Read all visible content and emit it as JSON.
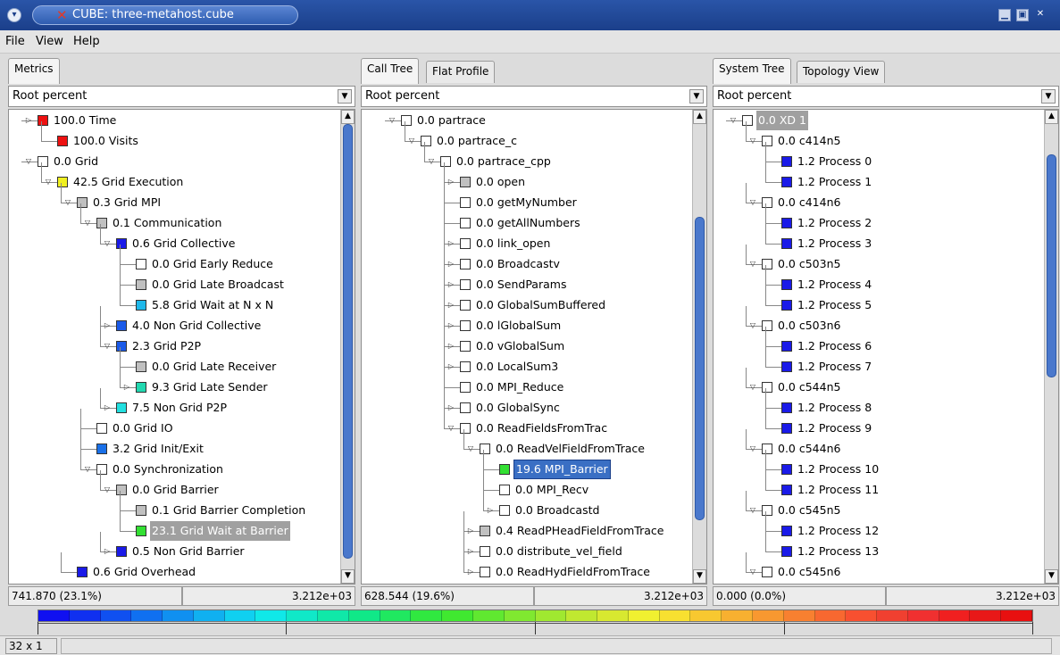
{
  "window": {
    "title": "CUBE: three-metahost.cube",
    "icon": "x-app-icon"
  },
  "menu": {
    "file": "File",
    "view": "View",
    "help": "Help"
  },
  "metrics": {
    "tab": "Metrics",
    "combo": "Root percent",
    "status_left": "741.870  (23.1%)",
    "status_right": "3.212e+03",
    "rows": [
      {
        "depth": 0,
        "exp": "right",
        "color": "#ee1111",
        "label": "100.0 Time"
      },
      {
        "depth": 1,
        "exp": "none",
        "color": "#ee1111",
        "label": "100.0 Visits"
      },
      {
        "depth": 0,
        "exp": "down",
        "color": "#ffffff",
        "label": "0.0 Grid"
      },
      {
        "depth": 1,
        "exp": "down",
        "color": "#f0f020",
        "label": "42.5 Grid Execution"
      },
      {
        "depth": 2,
        "exp": "down",
        "color": "#c0c0c0",
        "label": "0.3 Grid MPI"
      },
      {
        "depth": 3,
        "exp": "down",
        "color": "#c0c0c0",
        "label": "0.1 Communication"
      },
      {
        "depth": 4,
        "exp": "down",
        "color": "#1a1ae8",
        "label": "0.6 Grid Collective"
      },
      {
        "depth": 5,
        "exp": "none",
        "color": "#ffffff",
        "label": "0.0 Grid Early Reduce"
      },
      {
        "depth": 5,
        "exp": "none",
        "color": "#c0c0c0",
        "label": "0.0 Grid Late Broadcast"
      },
      {
        "depth": 5,
        "exp": "none",
        "color": "#1fb8ea",
        "label": "5.8 Grid Wait at N x N"
      },
      {
        "depth": 4,
        "exp": "right",
        "color": "#1a5ae8",
        "label": "4.0 Non Grid Collective"
      },
      {
        "depth": 4,
        "exp": "down",
        "color": "#1a5ae8",
        "label": "2.3 Grid P2P"
      },
      {
        "depth": 5,
        "exp": "none",
        "color": "#c0c0c0",
        "label": "0.0 Grid Late Receiver"
      },
      {
        "depth": 5,
        "exp": "right",
        "color": "#22d8b0",
        "label": "9.3 Grid Late Sender"
      },
      {
        "depth": 4,
        "exp": "right",
        "color": "#22e0e0",
        "label": "7.5 Non Grid P2P"
      },
      {
        "depth": 3,
        "exp": "none",
        "color": "#ffffff",
        "label": "0.0 Grid IO"
      },
      {
        "depth": 3,
        "exp": "none",
        "color": "#1a70e8",
        "label": "3.2 Grid Init/Exit"
      },
      {
        "depth": 3,
        "exp": "down",
        "color": "#ffffff",
        "label": "0.0 Synchronization"
      },
      {
        "depth": 4,
        "exp": "down",
        "color": "#c0c0c0",
        "label": "0.0 Grid Barrier"
      },
      {
        "depth": 5,
        "exp": "none",
        "color": "#c0c0c0",
        "label": "0.1 Grid Barrier Completion"
      },
      {
        "depth": 5,
        "exp": "none",
        "color": "#33e033",
        "label": "23.1 Grid Wait at Barrier",
        "state": "hl"
      },
      {
        "depth": 4,
        "exp": "right",
        "color": "#1a1ae8",
        "label": "0.5 Non Grid Barrier"
      },
      {
        "depth": 2,
        "exp": "none",
        "color": "#1a1ae8",
        "label": "0.6 Grid Overhead"
      }
    ]
  },
  "calltree": {
    "tab_active": "Call Tree",
    "tab_other": "Flat Profile",
    "combo": "Root percent",
    "status_left": "628.544  (19.6%)",
    "status_right": "3.212e+03",
    "rows": [
      {
        "depth": 0,
        "exp": "down",
        "color": "#ffffff",
        "label": "0.0 partrace"
      },
      {
        "depth": 1,
        "exp": "down",
        "color": "#ffffff",
        "label": "0.0 partrace_c"
      },
      {
        "depth": 2,
        "exp": "down",
        "color": "#ffffff",
        "label": "0.0 partrace_cpp"
      },
      {
        "depth": 3,
        "exp": "right",
        "color": "#c0c0c0",
        "label": "0.0 open"
      },
      {
        "depth": 3,
        "exp": "none",
        "color": "#ffffff",
        "label": "0.0 getMyNumber"
      },
      {
        "depth": 3,
        "exp": "none",
        "color": "#ffffff",
        "label": "0.0 getAllNumbers"
      },
      {
        "depth": 3,
        "exp": "right",
        "color": "#ffffff",
        "label": "0.0 link_open"
      },
      {
        "depth": 3,
        "exp": "right",
        "color": "#ffffff",
        "label": "0.0 Broadcastv"
      },
      {
        "depth": 3,
        "exp": "right",
        "color": "#ffffff",
        "label": "0.0 SendParams"
      },
      {
        "depth": 3,
        "exp": "right",
        "color": "#ffffff",
        "label": "0.0 GlobalSumBuffered"
      },
      {
        "depth": 3,
        "exp": "right",
        "color": "#ffffff",
        "label": "0.0 lGlobalSum"
      },
      {
        "depth": 3,
        "exp": "right",
        "color": "#ffffff",
        "label": "0.0 vGlobalSum"
      },
      {
        "depth": 3,
        "exp": "right",
        "color": "#ffffff",
        "label": "0.0 LocalSum3"
      },
      {
        "depth": 3,
        "exp": "none",
        "color": "#ffffff",
        "label": "0.0 MPI_Reduce"
      },
      {
        "depth": 3,
        "exp": "right",
        "color": "#ffffff",
        "label": "0.0 GlobalSync"
      },
      {
        "depth": 3,
        "exp": "down",
        "color": "#ffffff",
        "label": "0.0 ReadFieldsFromTrac"
      },
      {
        "depth": 4,
        "exp": "down",
        "color": "#ffffff",
        "label": "0.0 ReadVelFieldFromTrace"
      },
      {
        "depth": 5,
        "exp": "none",
        "color": "#33e033",
        "label": "19.6 MPI_Barrier",
        "state": "sel"
      },
      {
        "depth": 5,
        "exp": "none",
        "color": "#ffffff",
        "label": "0.0 MPI_Recv"
      },
      {
        "depth": 5,
        "exp": "right",
        "color": "#ffffff",
        "label": "0.0 Broadcastd"
      },
      {
        "depth": 4,
        "exp": "right",
        "color": "#c0c0c0",
        "label": "0.4 ReadPHeadFieldFromTrace"
      },
      {
        "depth": 4,
        "exp": "right",
        "color": "#ffffff",
        "label": "0.0 distribute_vel_field"
      },
      {
        "depth": 4,
        "exp": "right",
        "color": "#ffffff",
        "label": "0.0 ReadHydFieldFromTrace"
      }
    ]
  },
  "systemtree": {
    "tab_active": "System Tree",
    "tab_other": "Topology View",
    "combo": "Root percent",
    "status_left": "0.000  (0.0%)",
    "status_right": "3.212e+03",
    "rows": [
      {
        "depth": 0,
        "exp": "down",
        "color": "#ffffff",
        "label": "0.0 XD 1",
        "state": "hl"
      },
      {
        "depth": 1,
        "exp": "down",
        "color": "#ffffff",
        "label": "0.0 c414n5"
      },
      {
        "depth": 2,
        "exp": "none",
        "color": "#1a1ae8",
        "label": "1.2 Process 0"
      },
      {
        "depth": 2,
        "exp": "none",
        "color": "#1a1ae8",
        "label": "1.2 Process 1"
      },
      {
        "depth": 1,
        "exp": "down",
        "color": "#ffffff",
        "label": "0.0 c414n6"
      },
      {
        "depth": 2,
        "exp": "none",
        "color": "#1a1ae8",
        "label": "1.2 Process 2"
      },
      {
        "depth": 2,
        "exp": "none",
        "color": "#1a1ae8",
        "label": "1.2 Process 3"
      },
      {
        "depth": 1,
        "exp": "down",
        "color": "#ffffff",
        "label": "0.0 c503n5"
      },
      {
        "depth": 2,
        "exp": "none",
        "color": "#1a1ae8",
        "label": "1.2 Process 4"
      },
      {
        "depth": 2,
        "exp": "none",
        "color": "#1a1ae8",
        "label": "1.2 Process 5"
      },
      {
        "depth": 1,
        "exp": "down",
        "color": "#ffffff",
        "label": "0.0 c503n6"
      },
      {
        "depth": 2,
        "exp": "none",
        "color": "#1a1ae8",
        "label": "1.2 Process 6"
      },
      {
        "depth": 2,
        "exp": "none",
        "color": "#1a1ae8",
        "label": "1.2 Process 7"
      },
      {
        "depth": 1,
        "exp": "down",
        "color": "#ffffff",
        "label": "0.0 c544n5"
      },
      {
        "depth": 2,
        "exp": "none",
        "color": "#1a1ae8",
        "label": "1.2 Process 8"
      },
      {
        "depth": 2,
        "exp": "none",
        "color": "#1a1ae8",
        "label": "1.2 Process 9"
      },
      {
        "depth": 1,
        "exp": "down",
        "color": "#ffffff",
        "label": "0.0 c544n6"
      },
      {
        "depth": 2,
        "exp": "none",
        "color": "#1a1ae8",
        "label": "1.2 Process 10"
      },
      {
        "depth": 2,
        "exp": "none",
        "color": "#1a1ae8",
        "label": "1.2 Process 11"
      },
      {
        "depth": 1,
        "exp": "down",
        "color": "#ffffff",
        "label": "0.0 c545n5"
      },
      {
        "depth": 2,
        "exp": "none",
        "color": "#1a1ae8",
        "label": "1.2 Process 12"
      },
      {
        "depth": 2,
        "exp": "none",
        "color": "#1a1ae8",
        "label": "1.2 Process 13"
      },
      {
        "depth": 1,
        "exp": "down",
        "color": "#ffffff",
        "label": "0.0 c545n6"
      }
    ]
  },
  "colorbar": {
    "colors": [
      "#1010f0",
      "#1030f0",
      "#1050f0",
      "#1070f0",
      "#1090f0",
      "#10b0f0",
      "#10d0f0",
      "#10e8e8",
      "#10e8c8",
      "#10e8a8",
      "#10e888",
      "#20e860",
      "#30e840",
      "#40e830",
      "#60e830",
      "#80e830",
      "#a0e830",
      "#c0e830",
      "#d8e830",
      "#f0f030",
      "#f8e030",
      "#f8c830",
      "#f8b030",
      "#f89830",
      "#f88030",
      "#f86830",
      "#f85030",
      "#f04030",
      "#f03030",
      "#f02020",
      "#e81818",
      "#e81010"
    ],
    "status": "32 x 1"
  }
}
